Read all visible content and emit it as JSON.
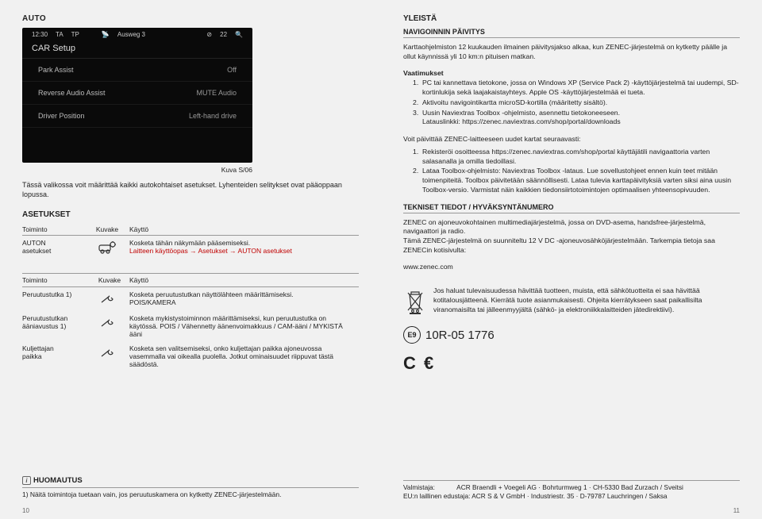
{
  "left": {
    "title": "AUTO",
    "screenshot": {
      "status": {
        "time": "12:30",
        "ta": "TA",
        "tp": "TP",
        "sat": "Ausweg 3",
        "mute": "⊘",
        "vol": "22",
        "bt": "⌕"
      },
      "title": "CAR Setup",
      "rows": [
        {
          "l": "Park Assist",
          "r": "Off"
        },
        {
          "l": "Reverse Audio Assist",
          "r": "MUTE Audio"
        },
        {
          "l": "Driver Position",
          "r": "Left-hand drive"
        }
      ]
    },
    "caption": "Kuva S/06",
    "intro": "Tässä valikossa voit määrittää kaikki autokohtaiset asetukset. Lyhenteiden selitykset ovat pääoppaan lopussa.",
    "asetukset_h": "ASETUKSET",
    "col_h": {
      "a": "Toiminto",
      "b": "Kuvake",
      "c": "Käyttö"
    },
    "row_auto": {
      "a": "AUTON\nasetukset",
      "c1": "Kosketa tähän näkymään pääsemiseksi.",
      "c2": "Laitteen käyttöopas → Asetukset → AUTON asetukset"
    },
    "row2_h": {
      "a": "Toiminto",
      "b": "Kuvake",
      "c": "Käyttö"
    },
    "rows2": [
      {
        "a": "Peruutustutka 1)",
        "c": "Kosketa peruutustutkan näyttölähteen määrittämiseksi.\nPOIS/KAMERA"
      },
      {
        "a": "Peruutustutkan\nääniavustus 1)",
        "c": "Kosketa mykistystoiminnon määrittämiseksi, kun peruutustutka on käytössä. POIS / Vähennetty äänenvoimakkuus / CAM-ääni / MYKISTÄ ääni"
      },
      {
        "a": "Kuljettajan\npaikka",
        "c": "Kosketa sen valitsemiseksi, onko kuljettajan paikka ajoneuvossa vasemmalla vai oikealla puolella. Jotkut ominaisuudet riippuvat tästä säädöstä."
      }
    ],
    "note_h": "HUOMAUTUS",
    "note_t": "1) Näitä toimintoja tuetaan vain, jos peruutuskamera on kytketty ZENEC-järjestelmään.",
    "pagenum": "10"
  },
  "right": {
    "title": "YLEISTÄ",
    "sub1": "NAVIGOINNIN PÄIVITYS",
    "p1": "Karttaohjelmiston 12 kuukauden ilmainen päivitysjakso alkaa, kun ZENEC-järjestelmä on kytketty päälle ja ollut käynnissä yli 10 km:n pituisen matkan.",
    "vaat_h": "Vaatimukset",
    "vaat": [
      "PC tai kannettava tietokone, jossa on Windows XP (Service Pack 2) -käyttöjärjestelmä tai uudempi, SD-kortinlukija sekä laajakaistayhteys. Apple OS -käyttöjärjestelmää ei tueta.",
      "Aktivoitu navigointikartta microSD-kortilla (määritetty sisältö).",
      "Uusin Naviextras Toolbox -ohjelmisto, asennettu tietokoneeseen.\nLatauslinkki: https://zenec.naviextras.com/shop/portal/downloads"
    ],
    "p2": "Voit päivittää ZENEC-laitteeseen uudet kartat seuraavasti:",
    "steps": [
      "Rekisteröi osoitteessa https://zenec.naviextras.com/shop/portal käyttäjätili navigaattoria varten salasanalla ja omilla tiedoillasi.",
      "Lataa Toolbox-ohjelmisto: Naviextras Toolbox -lataus. Lue sovellustohjeet ennen kuin teet mitään toimenpiteitä. Toolbox päivitetään säännöllisesti. Lataa tulevia karttapäivityksiä varten siksi aina uusin Toolbox-versio. Varmistat näin kaikkien tiedonsiirtotoimintojen optimaalisen yhteensopivuuden."
    ],
    "sub2": "TEKNISET TIEDOT / HYVÄKSYNTÄNUMERO",
    "p3": "ZENEC on ajoneuvokohtainen multimediajärjestelmä, jossa on DVD-asema, handsfree-järjestelmä, navigaattori ja radio.\nTämä ZENEC-järjestelmä on suunniteltu 12 V DC -ajoneuvosähköjärjestelmään. Tarkempia tietoja saa ZENECin kotisivulta:",
    "url": "www.zenec.com",
    "disposal": "Jos haluat tulevaisuudessa hävittää tuotteen, muista, että sähkötuotteita ei saa hävittää kotitalousjätteenä. Kierrätä tuote asianmukaisesti. Ohjeita kierrätykseen saat paikallisilta viranomaisilta tai jälleenmyyjältä (sähkö- ja elektroniikkalaitteiden jätedirektiivi).",
    "cert": "10R-05 1776",
    "mfr1": "Valmistaja:            ACR Braendli + Voegeli AG · Bohrturmweg 1 · CH-5330 Bad Zurzach / Sveitsi",
    "mfr2": "EU:n laillinen edustaja: ACR S & V GmbH · Industriestr. 35 · D-79787 Lauchringen / Saksa",
    "pagenum": "11"
  }
}
